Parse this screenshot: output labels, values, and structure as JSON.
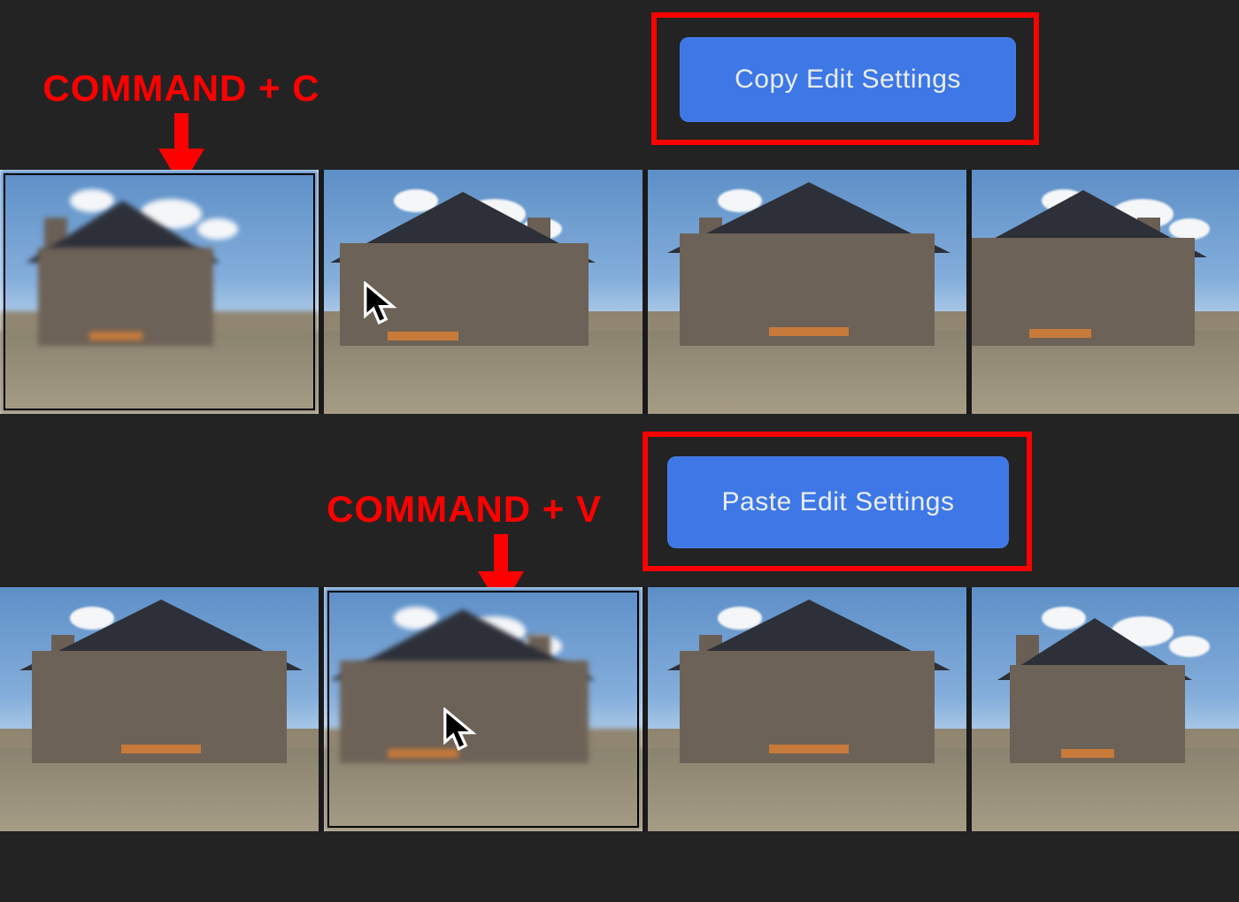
{
  "annotations": {
    "copy_label": "COMMAND + C",
    "paste_label": "COMMAND + V"
  },
  "buttons": {
    "copy_label": "Copy Edit Settings",
    "paste_label": "Paste Edit Settings"
  },
  "colors": {
    "annotation_red": "#ff0000",
    "button_blue": "#3e77e6",
    "app_background": "#232323"
  },
  "filmstrip_top": {
    "selected_index": 0,
    "thumbs": [
      {
        "variant": "v1",
        "selected": true
      },
      {
        "variant": "v2",
        "selected": false
      },
      {
        "variant": "v3",
        "selected": false
      },
      {
        "variant": "v4",
        "selected": false
      }
    ]
  },
  "filmstrip_bottom": {
    "selected_index": 1,
    "thumbs": [
      {
        "variant": "v3",
        "selected": false
      },
      {
        "variant": "v2",
        "selected": true
      },
      {
        "variant": "v3",
        "selected": false
      },
      {
        "variant": "v1",
        "selected": false
      }
    ]
  }
}
